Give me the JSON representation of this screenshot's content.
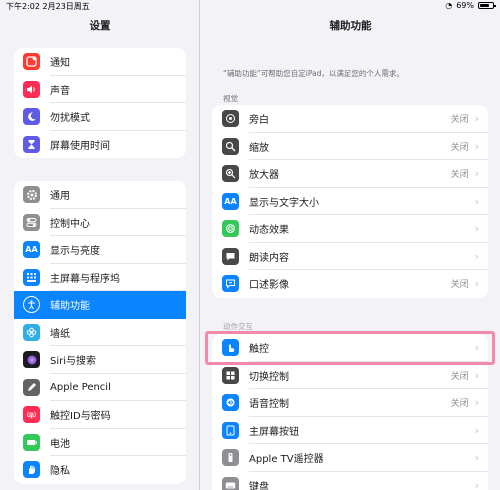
{
  "status_bar": {
    "time": "下午2:02",
    "date": "2月23日周五",
    "battery": "69%"
  },
  "sidebar": {
    "title": "设置",
    "group1": [
      {
        "label": "通知",
        "icon": "notification-icon"
      },
      {
        "label": "声音",
        "icon": "sound-icon"
      },
      {
        "label": "勿扰模式",
        "icon": "moon-icon"
      },
      {
        "label": "屏幕使用时间",
        "icon": "hourglass-icon"
      }
    ],
    "group2": [
      {
        "label": "通用",
        "icon": "gear-icon"
      },
      {
        "label": "控制中心",
        "icon": "toggles-icon"
      },
      {
        "label": "显示与亮度",
        "icon": "display-icon"
      },
      {
        "label": "主屏幕与程序坞",
        "icon": "grid-icon"
      },
      {
        "label": "辅助功能",
        "icon": "accessibility-icon",
        "active": true
      },
      {
        "label": "墙纸",
        "icon": "flower-icon"
      },
      {
        "label": "Siri与搜索",
        "icon": "siri-icon"
      },
      {
        "label": "Apple Pencil",
        "icon": "pencil-icon"
      },
      {
        "label": "触控ID与密码",
        "icon": "fingerprint-icon"
      },
      {
        "label": "电池",
        "icon": "battery-icon"
      },
      {
        "label": "隐私",
        "icon": "hand-icon"
      }
    ]
  },
  "main": {
    "title": "辅助功能",
    "description": "“辅助功能”可帮助您自定iPad，以满足您的个人需求。",
    "vision_header": "视觉",
    "vision_items": [
      {
        "label": "旁白",
        "value": "关闭",
        "icon": "voiceover-icon"
      },
      {
        "label": "缩放",
        "value": "关闭",
        "icon": "zoom-icon"
      },
      {
        "label": "放大器",
        "value": "关闭",
        "icon": "magnifier-icon"
      },
      {
        "label": "显示与文字大小",
        "value": "",
        "icon": "text-size-icon"
      },
      {
        "label": "动态效果",
        "value": "",
        "icon": "motion-icon"
      },
      {
        "label": "朗读内容",
        "value": "",
        "icon": "speech-icon"
      },
      {
        "label": "口述影像",
        "value": "关闭",
        "icon": "audio-description-icon"
      }
    ],
    "interaction_header": "动作交互",
    "interaction_items": [
      {
        "label": "触控",
        "value": "",
        "icon": "touch-icon"
      },
      {
        "label": "切换控制",
        "value": "关闭",
        "icon": "switch-control-icon"
      },
      {
        "label": "语音控制",
        "value": "关闭",
        "icon": "voice-control-icon"
      },
      {
        "label": "主屏幕按钮",
        "value": "",
        "icon": "home-button-icon"
      },
      {
        "label": "Apple TV遥控器",
        "value": "",
        "icon": "remote-icon"
      },
      {
        "label": "键盘",
        "value": "",
        "icon": "keyboard-icon"
      }
    ]
  }
}
